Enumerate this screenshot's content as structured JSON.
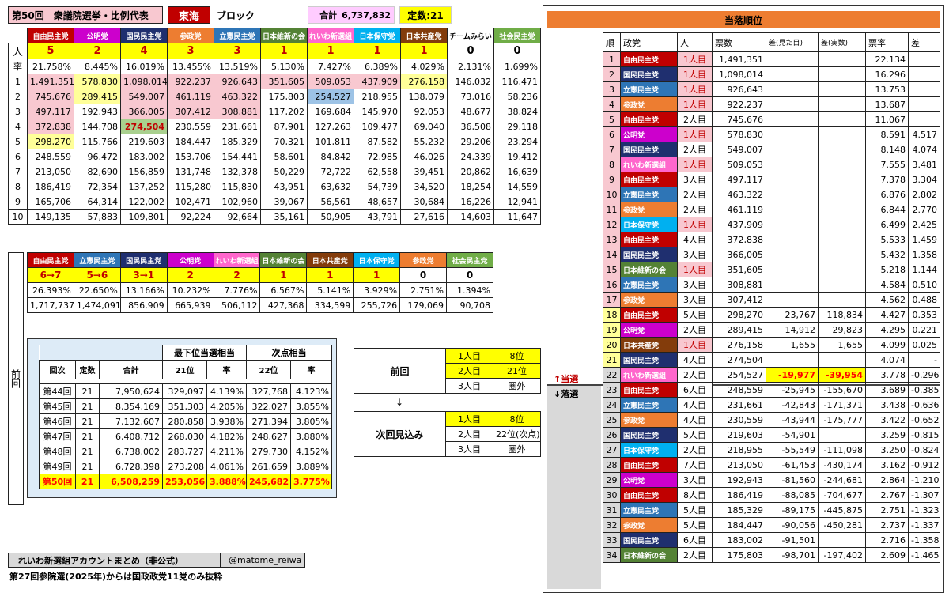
{
  "header": {
    "title": "第50回　衆議院選挙・比例代表",
    "block_name": "東海",
    "block_suffix": "ブロック",
    "total_label": "合計",
    "total_value": "6,737,832",
    "seats_label": "定数:21"
  },
  "parties": [
    {
      "name": "自由民主党",
      "color": "#c00000",
      "seats": "5",
      "rate": "21.758%"
    },
    {
      "name": "公明党",
      "color": "#cc00cc",
      "seats": "2",
      "rate": "8.445%"
    },
    {
      "name": "国民民主党",
      "color": "#1f2f6f",
      "seats": "4",
      "rate": "16.019%"
    },
    {
      "name": "参政党",
      "color": "#ed7d31",
      "seats": "3",
      "rate": "13.455%"
    },
    {
      "name": "立憲民主党",
      "color": "#2e75b6",
      "seats": "3",
      "rate": "13.519%"
    },
    {
      "name": "日本維新の会",
      "color": "#548235",
      "seats": "1",
      "rate": "5.130%"
    },
    {
      "name": "れいわ新選組",
      "color": "#ff66cc",
      "seats": "1",
      "rate": "7.427%"
    },
    {
      "name": "日本保守党",
      "color": "#00b0f0",
      "seats": "1",
      "rate": "6.389%"
    },
    {
      "name": "日本共産党",
      "color": "#833c0b",
      "seats": "1",
      "rate": "4.029%"
    },
    {
      "name": "チームみらい",
      "color": "#ffffff",
      "seats": "0",
      "rate": "2.131%"
    },
    {
      "name": "社会民主党",
      "color": "#70ad47",
      "seats": "0",
      "rate": "1.699%"
    }
  ],
  "row_labels": {
    "seats": "人",
    "rate": "率"
  },
  "quotients": [
    [
      "1,491,351",
      "578,830",
      "1,098,014",
      "922,237",
      "926,643",
      "351,605",
      "509,053",
      "437,909",
      "276,158",
      "146,032",
      "116,471"
    ],
    [
      "745,676",
      "289,415",
      "549,007",
      "461,119",
      "463,322",
      "175,803",
      "254,527",
      "218,955",
      "138,079",
      "73,016",
      "58,236"
    ],
    [
      "497,117",
      "192,943",
      "366,005",
      "307,412",
      "308,881",
      "117,202",
      "169,684",
      "145,970",
      "92,053",
      "48,677",
      "38,824"
    ],
    [
      "372,838",
      "144,708",
      "274,504",
      "230,559",
      "231,661",
      "87,901",
      "127,263",
      "109,477",
      "69,040",
      "36,508",
      "29,118"
    ],
    [
      "298,270",
      "115,766",
      "219,603",
      "184,447",
      "185,329",
      "70,321",
      "101,811",
      "87,582",
      "55,232",
      "29,206",
      "23,294"
    ],
    [
      "248,559",
      "96,472",
      "183,002",
      "153,706",
      "154,441",
      "58,601",
      "84,842",
      "72,985",
      "46,026",
      "24,339",
      "19,412"
    ],
    [
      "213,050",
      "82,690",
      "156,859",
      "131,748",
      "132,378",
      "50,229",
      "72,722",
      "62,558",
      "39,451",
      "20,862",
      "16,639"
    ],
    [
      "186,419",
      "72,354",
      "137,252",
      "115,280",
      "115,830",
      "43,951",
      "63,632",
      "54,739",
      "34,520",
      "18,254",
      "14,559"
    ],
    [
      "165,706",
      "64,314",
      "122,002",
      "102,471",
      "102,960",
      "39,067",
      "56,561",
      "48,657",
      "30,684",
      "16,226",
      "12,941"
    ],
    [
      "149,135",
      "57,883",
      "109,801",
      "92,224",
      "92,664",
      "35,161",
      "50,905",
      "43,791",
      "27,616",
      "14,603",
      "11,647"
    ]
  ],
  "quotient_highlights": [
    [
      "pink",
      "yellow",
      "pink",
      "pink",
      "pink",
      "pink",
      "pink",
      "pink",
      "yellow",
      "",
      ""
    ],
    [
      "pink",
      "yellow",
      "pink",
      "pink",
      "pink",
      "",
      "blue",
      "",
      "",
      "",
      ""
    ],
    [
      "pink",
      "",
      "pink",
      "pink",
      "pink",
      "",
      "",
      "",
      "",
      "",
      ""
    ],
    [
      "pink",
      "",
      "green",
      "",
      "",
      "",
      "",
      "",
      "",
      "",
      ""
    ],
    [
      "yellow",
      "",
      "",
      "",
      "",
      "",
      "",
      "",
      "",
      "",
      ""
    ],
    [
      "",
      "",
      "",
      "",
      "",
      "",
      "",
      "",
      "",
      "",
      ""
    ],
    [
      "",
      "",
      "",
      "",
      "",
      "",
      "",
      "",
      "",
      "",
      ""
    ],
    [
      "",
      "",
      "",
      "",
      "",
      "",
      "",
      "",
      "",
      "",
      ""
    ],
    [
      "",
      "",
      "",
      "",
      "",
      "",
      "",
      "",
      "",
      "",
      ""
    ],
    [
      "",
      "",
      "",
      "",
      "",
      "",
      "",
      "",
      "",
      "",
      ""
    ]
  ],
  "previous": {
    "side_label": "前回",
    "parties": [
      {
        "name": "自由民主党",
        "color": "#c00000",
        "seats": "6→7",
        "rate": "26.393%",
        "votes": "1,717,737"
      },
      {
        "name": "立憲民主党",
        "color": "#2e75b6",
        "seats": "5→6",
        "rate": "22.650%",
        "votes": "1,474,091"
      },
      {
        "name": "国民民主党",
        "color": "#1f2f6f",
        "seats": "3→1",
        "rate": "13.166%",
        "votes": "856,909"
      },
      {
        "name": "公明党",
        "color": "#cc00cc",
        "seats": "2",
        "rate": "10.232%",
        "votes": "665,939"
      },
      {
        "name": "れいわ新選組",
        "color": "#ff66cc",
        "seats": "2",
        "rate": "7.776%",
        "votes": "506,112"
      },
      {
        "name": "日本維新の会",
        "color": "#548235",
        "seats": "1",
        "rate": "6.567%",
        "votes": "427,368"
      },
      {
        "name": "日本共産党",
        "color": "#833c0b",
        "seats": "1",
        "rate": "5.141%",
        "votes": "334,599"
      },
      {
        "name": "日本保守党",
        "color": "#00b0f0",
        "seats": "1",
        "rate": "3.929%",
        "votes": "255,726"
      },
      {
        "name": "参政党",
        "color": "#ed7d31",
        "seats": "0",
        "rate": "2.751%",
        "votes": "179,069"
      },
      {
        "name": "社会民主党",
        "color": "#70ad47",
        "seats": "0",
        "rate": "1.394%",
        "votes": "90,708"
      }
    ]
  },
  "history": {
    "group1": "最下位当選相当",
    "group2": "次点相当",
    "headers": [
      "回次",
      "定数",
      "合計",
      "21位",
      "率",
      "22位",
      "率"
    ],
    "rows": [
      [
        "第44回",
        "21",
        "7,950,624",
        "329,097",
        "4.139%",
        "327,768",
        "4.123%"
      ],
      [
        "第45回",
        "21",
        "8,354,169",
        "351,303",
        "4.205%",
        "322,027",
        "3.855%"
      ],
      [
        "第46回",
        "21",
        "7,132,607",
        "280,858",
        "3.938%",
        "271,394",
        "3.805%"
      ],
      [
        "第47回",
        "21",
        "6,408,712",
        "268,030",
        "4.182%",
        "248,627",
        "3.880%"
      ],
      [
        "第48回",
        "21",
        "6,738,002",
        "283,727",
        "4.211%",
        "279,730",
        "4.152%"
      ],
      [
        "第49回",
        "21",
        "6,728,398",
        "273,208",
        "4.061%",
        "261,659",
        "3.889%"
      ],
      [
        "第50回",
        "21",
        "6,508,259",
        "253,056",
        "3.888%",
        "245,682",
        "3.775%"
      ]
    ]
  },
  "prev_result": {
    "label": "前回",
    "rows": [
      [
        "1人目",
        "8位"
      ],
      [
        "2人目",
        "21位"
      ],
      [
        "3人目",
        "圏外"
      ]
    ]
  },
  "arrow": "↓",
  "next_forecast": {
    "label": "次回見込み",
    "rows": [
      [
        "1人目",
        "8位"
      ],
      [
        "2人目",
        "22位(次点)"
      ],
      [
        "3人目",
        "圏外"
      ]
    ]
  },
  "ranking": {
    "title": "当落順位",
    "headers": [
      "順",
      "政党",
      "人",
      "票数",
      "差(見た目)",
      "差(実数)",
      "票率",
      "差"
    ],
    "elected_label": "↑当選",
    "defeated_label": "↓落選",
    "rows": [
      [
        "1",
        "自由民主党",
        "1人目",
        "1,491,351",
        "",
        "",
        "22.134",
        ""
      ],
      [
        "2",
        "国民民主党",
        "1人目",
        "1,098,014",
        "",
        "",
        "16.296",
        ""
      ],
      [
        "3",
        "立憲民主党",
        "1人目",
        "926,643",
        "",
        "",
        "13.753",
        ""
      ],
      [
        "4",
        "参政党",
        "1人目",
        "922,237",
        "",
        "",
        "13.687",
        ""
      ],
      [
        "5",
        "自由民主党",
        "2人目",
        "745,676",
        "",
        "",
        "11.067",
        ""
      ],
      [
        "6",
        "公明党",
        "1人目",
        "578,830",
        "",
        "",
        "8.591",
        "4.517"
      ],
      [
        "7",
        "国民民主党",
        "2人目",
        "549,007",
        "",
        "",
        "8.148",
        "4.074"
      ],
      [
        "8",
        "れいわ新選組",
        "1人目",
        "509,053",
        "",
        "",
        "7.555",
        "3.481"
      ],
      [
        "9",
        "自由民主党",
        "3人目",
        "497,117",
        "",
        "",
        "7.378",
        "3.304"
      ],
      [
        "10",
        "立憲民主党",
        "2人目",
        "463,322",
        "",
        "",
        "6.876",
        "2.802"
      ],
      [
        "11",
        "参政党",
        "2人目",
        "461,119",
        "",
        "",
        "6.844",
        "2.770"
      ],
      [
        "12",
        "日本保守党",
        "1人目",
        "437,909",
        "",
        "",
        "6.499",
        "2.425"
      ],
      [
        "13",
        "自由民主党",
        "4人目",
        "372,838",
        "",
        "",
        "5.533",
        "1.459"
      ],
      [
        "14",
        "国民民主党",
        "3人目",
        "366,005",
        "",
        "",
        "5.432",
        "1.358"
      ],
      [
        "15",
        "日本維新の会",
        "1人目",
        "351,605",
        "",
        "",
        "5.218",
        "1.144"
      ],
      [
        "16",
        "立憲民主党",
        "3人目",
        "308,881",
        "",
        "",
        "4.584",
        "0.510"
      ],
      [
        "17",
        "参政党",
        "3人目",
        "307,412",
        "",
        "",
        "4.562",
        "0.488"
      ],
      [
        "18",
        "自由民主党",
        "5人目",
        "298,270",
        "23,767",
        "118,834",
        "4.427",
        "0.353"
      ],
      [
        "19",
        "公明党",
        "2人目",
        "289,415",
        "14,912",
        "29,823",
        "4.295",
        "0.221"
      ],
      [
        "20",
        "日本共産党",
        "1人目",
        "276,158",
        "1,655",
        "1,655",
        "4.099",
        "0.025"
      ],
      [
        "21",
        "国民民主党",
        "4人目",
        "274,504",
        "",
        "",
        "4.074",
        "-"
      ],
      [
        "22",
        "れいわ新選組",
        "2人目",
        "254,527",
        "-19,977",
        "-39,954",
        "3.778",
        "-0.296"
      ],
      [
        "23",
        "自由民主党",
        "6人目",
        "248,559",
        "-25,945",
        "-155,670",
        "3.689",
        "-0.385"
      ],
      [
        "24",
        "立憲民主党",
        "4人目",
        "231,661",
        "-42,843",
        "-171,371",
        "3.438",
        "-0.636"
      ],
      [
        "25",
        "参政党",
        "4人目",
        "230,559",
        "-43,944",
        "-175,777",
        "3.422",
        "-0.652"
      ],
      [
        "26",
        "国民民主党",
        "5人目",
        "219,603",
        "-54,901",
        "",
        "3.259",
        "-0.815"
      ],
      [
        "27",
        "日本保守党",
        "2人目",
        "218,955",
        "-55,549",
        "-111,098",
        "3.250",
        "-0.824"
      ],
      [
        "28",
        "自由民主党",
        "7人目",
        "213,050",
        "-61,453",
        "-430,174",
        "3.162",
        "-0.912"
      ],
      [
        "29",
        "公明党",
        "3人目",
        "192,943",
        "-81,560",
        "-244,681",
        "2.864",
        "-1.210"
      ],
      [
        "30",
        "自由民主党",
        "8人目",
        "186,419",
        "-88,085",
        "-704,677",
        "2.767",
        "-1.307"
      ],
      [
        "31",
        "立憲民主党",
        "5人目",
        "185,329",
        "-89,175",
        "-445,875",
        "2.751",
        "-1.323"
      ],
      [
        "32",
        "参政党",
        "5人目",
        "184,447",
        "-90,056",
        "-450,281",
        "2.737",
        "-1.337"
      ],
      [
        "33",
        "国民民主党",
        "6人目",
        "183,002",
        "-91,501",
        "",
        "2.716",
        "-1.358"
      ],
      [
        "34",
        "日本維新の会",
        "2人目",
        "175,803",
        "-98,701",
        "-197,402",
        "2.609",
        "-1.465"
      ]
    ]
  },
  "footer": {
    "account": "れいわ新選組アカウントまとめ（非公式）",
    "handle": "@matome_reiwa",
    "note": "第27回参院選(2025年)からは国政政党11党のみ抜粋"
  },
  "colors": {
    "pink": "#f8c8d0",
    "yellow": "#ffff00",
    "lightyellow": "#ffffcc",
    "blue": "#9dc3e6",
    "green": "#a9d08e",
    "orange": "#ed7d31",
    "peach": "#f4b183",
    "gray": "#d9d9d9",
    "pinkbg": "#ffccff",
    "rank_pink": "#f8c8d0",
    "rank_yellow": "#ffff99"
  }
}
